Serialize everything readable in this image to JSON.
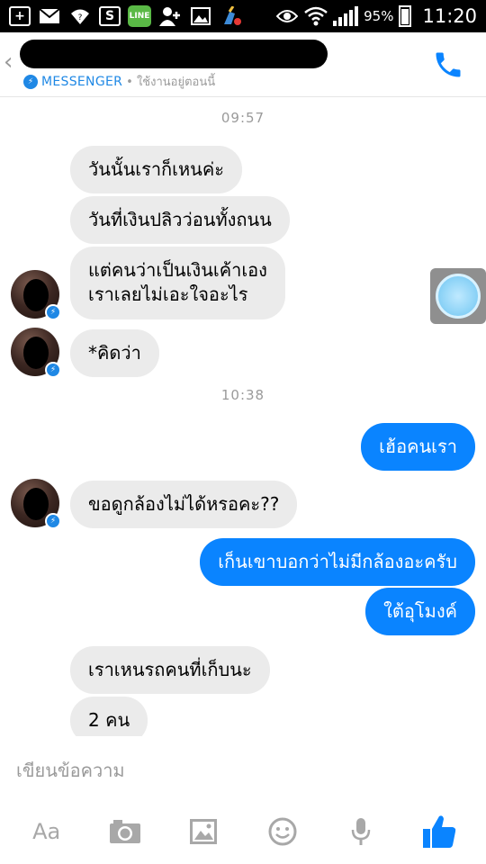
{
  "status_bar": {
    "battery": "95%",
    "time": "11:20",
    "line_label": "LINE"
  },
  "header": {
    "app_label": "MESSENGER",
    "active_status": "• ใช้งานอยู่ตอนนี้"
  },
  "messages": {
    "timestamps": [
      "09:57",
      "10:38"
    ],
    "items": [
      {
        "side": "in",
        "text": "วันนั้นเราก็เหนค่ะ"
      },
      {
        "side": "in",
        "text": "วันที่เงินปลิวว่อนทั้งถนน"
      },
      {
        "side": "in",
        "text": "แต่คนว่าเป็นเงินเค้าเอง\nเราเลยไม่เอะใจอะไร"
      },
      {
        "side": "in",
        "text": "*คิดว่า"
      },
      {
        "side": "out",
        "text": "เฮ้อคนเรา"
      },
      {
        "side": "in",
        "text": "ขอดูกล้องไม่ได้หรอคะ??"
      },
      {
        "side": "out",
        "text": "เก็นเขาบอกว่าไม่มีกล้องอะครับ"
      },
      {
        "side": "out",
        "text": "ใต้อุโมงค์"
      },
      {
        "side": "in",
        "text": "เราเหนรถคนที่เก็บนะ"
      },
      {
        "side": "in",
        "text": "2 คน"
      }
    ]
  },
  "composer": {
    "placeholder": "เขียนข้อความ",
    "text_button": "Aa"
  },
  "colors": {
    "accent": "#0a84ff",
    "incoming_bubble": "#ebebeb",
    "status_bar": "#000000"
  },
  "icons": [
    "plus-box-icon",
    "mail-icon",
    "wifi-question-icon",
    "skype-icon",
    "line-icon",
    "add-contact-icon",
    "image-icon",
    "cleaner-icon",
    "eye-icon",
    "wifi-icon",
    "signal-icon",
    "battery-icon",
    "phone-icon",
    "camera-icon",
    "gallery-icon",
    "emoji-icon",
    "microphone-icon",
    "thumbs-up-icon"
  ]
}
